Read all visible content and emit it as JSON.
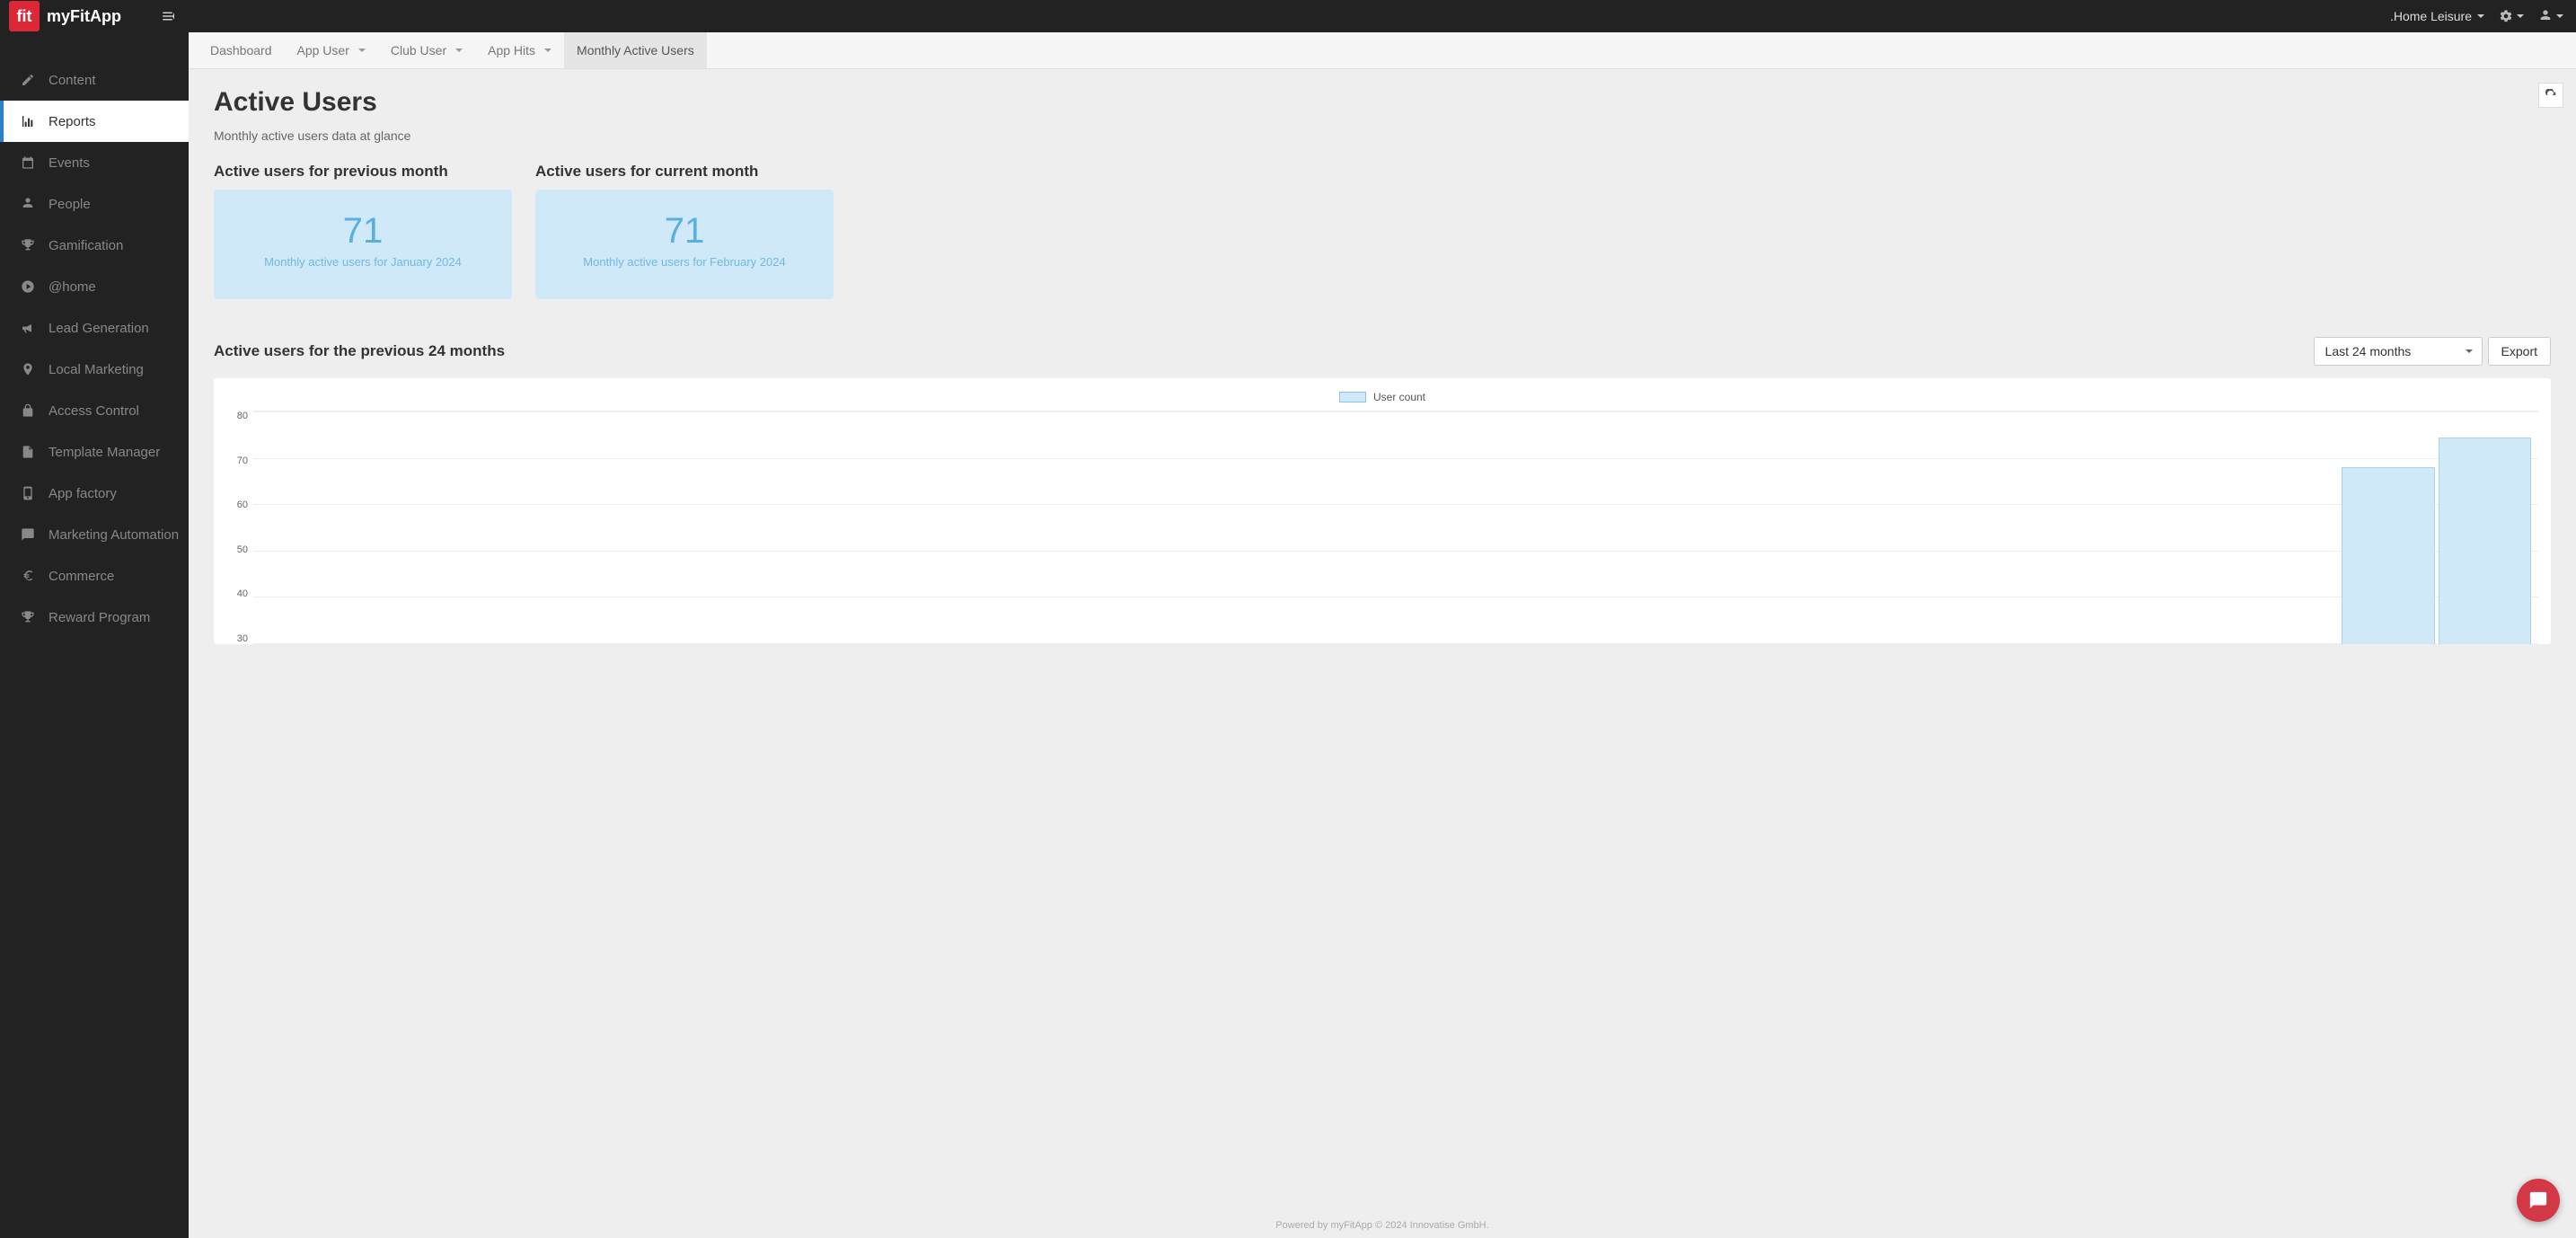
{
  "header": {
    "logo_short": "fit",
    "app_name": "myFitApp",
    "org_name": ".Home Leisure"
  },
  "sidebar": {
    "items": [
      {
        "label": "Content",
        "icon": "pencil"
      },
      {
        "label": "Reports",
        "icon": "bar-chart",
        "active": true
      },
      {
        "label": "Events",
        "icon": "calendar"
      },
      {
        "label": "People",
        "icon": "user"
      },
      {
        "label": "Gamification",
        "icon": "trophy"
      },
      {
        "label": "@home",
        "icon": "play-circle"
      },
      {
        "label": "Lead Generation",
        "icon": "bullhorn"
      },
      {
        "label": "Local Marketing",
        "icon": "map-pin"
      },
      {
        "label": "Access Control",
        "icon": "lock"
      },
      {
        "label": "Template Manager",
        "icon": "file"
      },
      {
        "label": "App factory",
        "icon": "mobile"
      },
      {
        "label": "Marketing Automation",
        "icon": "comment"
      },
      {
        "label": "Commerce",
        "icon": "euro"
      },
      {
        "label": "Reward Program",
        "icon": "trophy"
      }
    ]
  },
  "tabs": [
    {
      "label": "Dashboard"
    },
    {
      "label": "App User",
      "caret": true
    },
    {
      "label": "Club User",
      "caret": true
    },
    {
      "label": "App Hits",
      "caret": true
    },
    {
      "label": "Monthly Active Users",
      "active": true
    }
  ],
  "page": {
    "title": "Active Users",
    "subtitle": "Monthly active users data at glance"
  },
  "cards": {
    "prev": {
      "heading": "Active users for previous month",
      "value": "71",
      "label": "Monthly active users for January 2024"
    },
    "curr": {
      "heading": "Active users for current month",
      "value": "71",
      "label": "Monthly active users for February 2024"
    }
  },
  "chart_section": {
    "heading": "Active users for the previous 24 months",
    "range_selected": "Last 24 months",
    "export_label": "Export",
    "legend": "User count"
  },
  "chart_data": {
    "type": "bar",
    "title": "Active users for the previous 24 months",
    "xlabel": "",
    "ylabel": "",
    "ylim": [
      0,
      80
    ],
    "yticks": [
      30,
      40,
      50,
      60,
      70,
      80
    ],
    "series": [
      {
        "name": "User count",
        "values": [
          0,
          0,
          0,
          0,
          0,
          0,
          0,
          0,
          0,
          0,
          0,
          0,
          0,
          0,
          0,
          0,
          0,
          0,
          0,
          0,
          0,
          0,
          61,
          71
        ]
      }
    ]
  },
  "footer": "Powered by myFitApp © 2024 Innovatise GmbH."
}
